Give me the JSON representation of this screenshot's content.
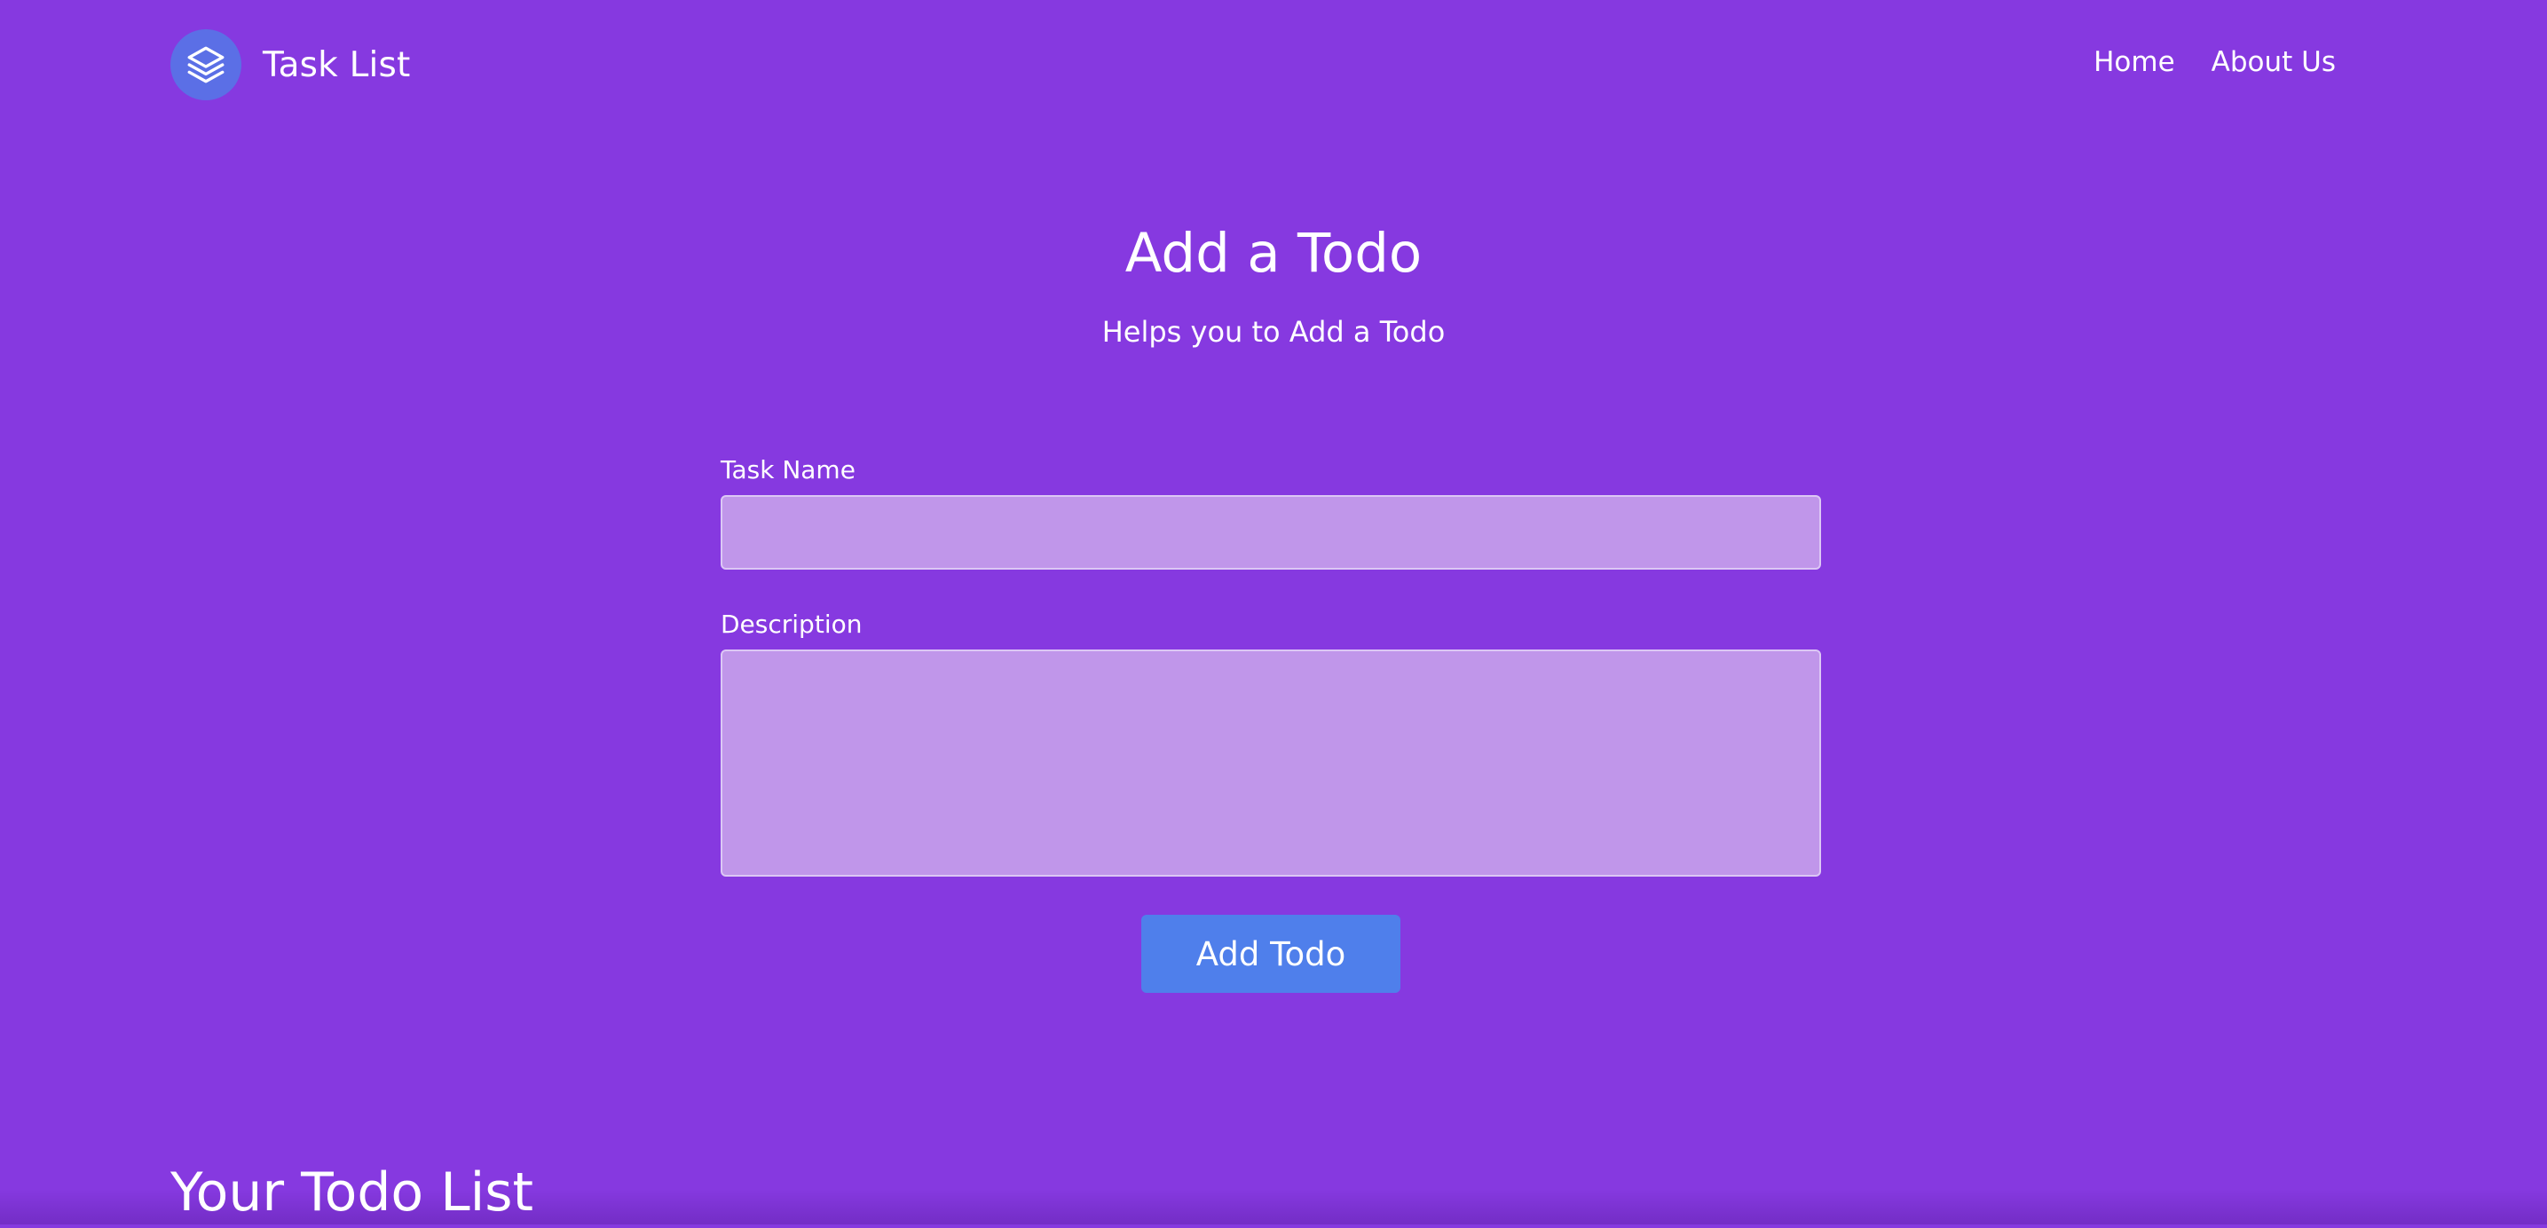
{
  "header": {
    "brand": "Task List",
    "logo_icon": "layers-icon",
    "nav": [
      {
        "label": "Home"
      },
      {
        "label": "About Us"
      }
    ]
  },
  "hero": {
    "title": "Add a Todo",
    "subtitle": "Helps you to Add a Todo"
  },
  "form": {
    "task_name_label": "Task Name",
    "task_name_value": "",
    "description_label": "Description",
    "description_value": "",
    "submit_label": "Add Todo"
  },
  "list": {
    "heading": "Your Todo List"
  },
  "colors": {
    "background": "#8639e0",
    "input_fill": "#c096ea",
    "button": "#4f7feb",
    "logo_circle": "#5b6fe6"
  }
}
